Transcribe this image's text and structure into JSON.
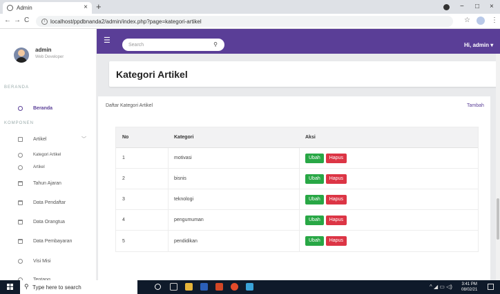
{
  "browser": {
    "tab_title": "Admin",
    "tab_close": "×",
    "new_tab": "+",
    "url": "localhost/ppdbnanda2/admin/index.php?page=kategori-artikel",
    "back": "←",
    "forward": "→",
    "reload": "C",
    "min": "−",
    "max": "□",
    "close": "×"
  },
  "header": {
    "search_placeholder": "Search",
    "greeting": "Hi, admin ▾"
  },
  "user": {
    "name": "admin",
    "role": "Web Developer"
  },
  "sidebar": {
    "section_beranda": "BERANDA",
    "section_komponen": "KOMPONEN",
    "items": [
      {
        "label": "Beranda"
      },
      {
        "label": "Artikel"
      },
      {
        "label": "Kategori Artikel"
      },
      {
        "label": "Artikel"
      },
      {
        "label": "Tahun Ajaran"
      },
      {
        "label": "Data Pendaftar"
      },
      {
        "label": "Data Orangtua"
      },
      {
        "label": "Data Pembayaran"
      },
      {
        "label": "Visi Misi"
      },
      {
        "label": "Tentang"
      }
    ]
  },
  "page": {
    "title": "Kategori Artikel",
    "card_title": "Daftar Kategori Artikel",
    "add_link": "Tambah"
  },
  "table": {
    "headers": [
      "No",
      "Kategori",
      "Aksi"
    ],
    "rows": [
      {
        "no": "1",
        "kategori": "motivasi"
      },
      {
        "no": "2",
        "kategori": "bisnis"
      },
      {
        "no": "3",
        "kategori": "teknologi"
      },
      {
        "no": "4",
        "kategori": "pengumuman"
      },
      {
        "no": "5",
        "kategori": "pendidikan"
      }
    ],
    "edit_label": "Ubah",
    "delete_label": "Hapus"
  },
  "taskbar": {
    "search_placeholder": "Type here to search",
    "time": "3:41 PM",
    "date": "08/02/21"
  },
  "colors": {
    "brand": "#5a3e97",
    "edit": "#28a745",
    "delete": "#dc3545"
  }
}
